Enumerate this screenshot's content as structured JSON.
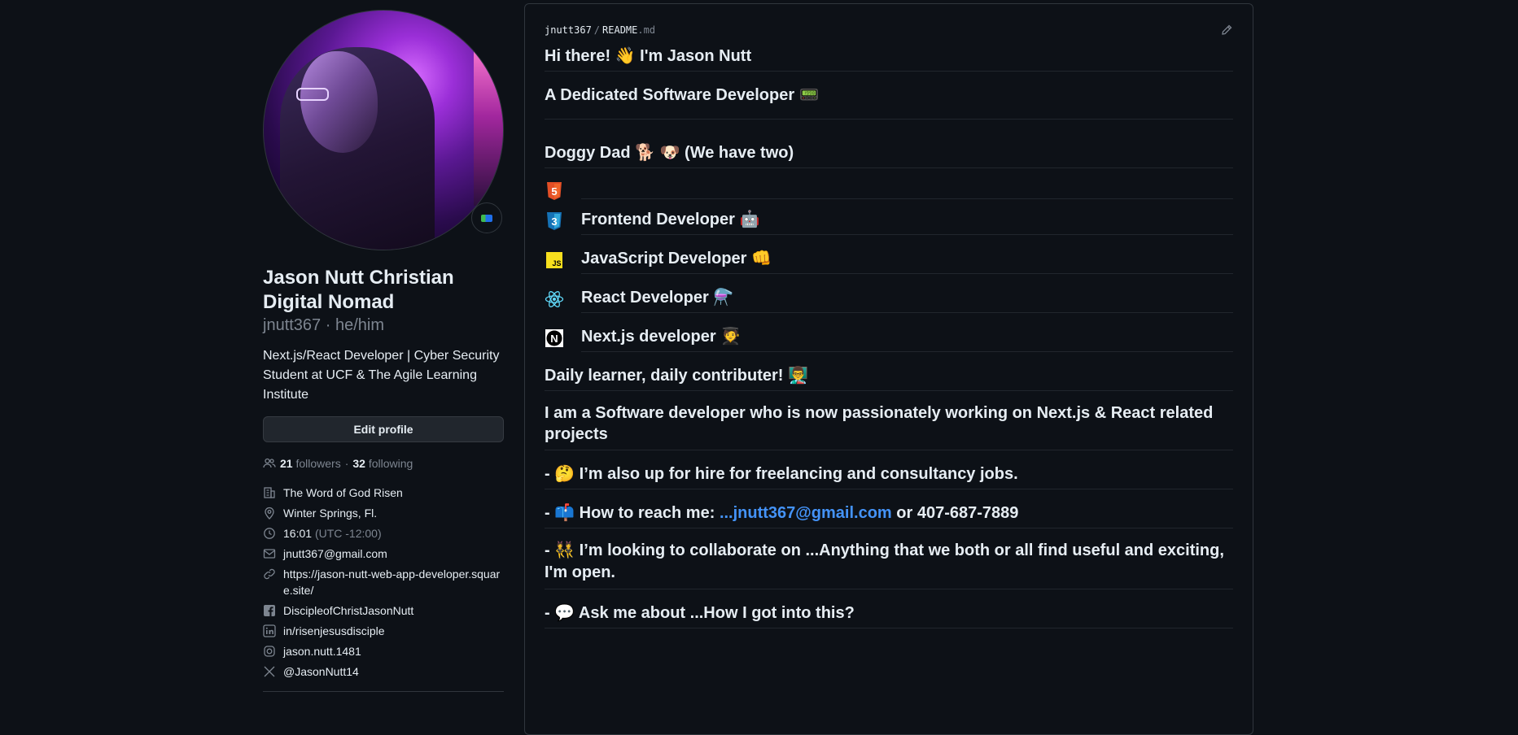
{
  "profile": {
    "name_line1": "Jason Nutt Christian",
    "name_line2": "Digital Nomad",
    "login": "jnutt367 · he/him",
    "bio": "Next.js/React Developer | Cyber Security Student at UCF & The Agile Learning Institute",
    "edit_button": "Edit profile",
    "followers_count": "21",
    "followers_label": "followers",
    "separator": "·",
    "following_count": "32",
    "following_label": "following",
    "details": {
      "company": "The Word of God Risen",
      "location": "Winter Springs, Fl.",
      "time": "16:01",
      "timezone": "(UTC -12:00)",
      "email": "jnutt367@gmail.com",
      "website": "https://jason-nutt-web-app-developer.square.site/",
      "facebook": "DiscipleofChristJasonNutt",
      "linkedin": "in/risenjesusdisciple",
      "instagram": "jason.nutt.1481",
      "twitter": "@JasonNutt14"
    },
    "icons": [
      "people-icon",
      "organization-icon",
      "location-icon",
      "clock-icon",
      "mail-icon",
      "link-icon",
      "facebook-icon",
      "linkedin-icon",
      "instagram-icon",
      "x-icon"
    ]
  },
  "readme": {
    "breadcrumb_user": "jnutt367",
    "breadcrumb_sep": "/",
    "breadcrumb_file": "README",
    "breadcrumb_ext": ".md",
    "lines": {
      "greeting": "Hi there! 👋 I'm Jason Nutt",
      "dedicated": "A Dedicated Software Developer 📟",
      "doggy": "Doggy Dad 🐕 🐶 (We have two)",
      "frontend": "Frontend Developer 🤖",
      "javascript": "JavaScript Developer 👊",
      "react": "React Developer ⚗️",
      "nextjs": "Next.js developer 🧑‍🎓",
      "learner": "Daily learner, daily contributer! 👨‍🏫",
      "working": "I am a Software developer who is now passionately working on Next.js & React related projects",
      "hire": "- 🤔 I’m also up for hire for freelancing and consultancy jobs.",
      "reach_prefix": "- 📫 How to reach me: ",
      "reach_link": "...jnutt367@gmail.com",
      "reach_suffix": " or 407-687-7889",
      "collab": "- 👯 I’m looking to collaborate on ...Anything that we both or all find useful and exciting, I'm open.",
      "ask": "- 💬 Ask me about ...How I got into this?"
    },
    "logos": {
      "html5": "5",
      "css3": "3",
      "js": "JS",
      "react": "⚛",
      "next": "N"
    },
    "colors": {
      "html5": "#e34f26",
      "css3": "#1572b6",
      "js": "#f7df1e",
      "react": "#61dafb",
      "link": "#4493f8"
    }
  }
}
